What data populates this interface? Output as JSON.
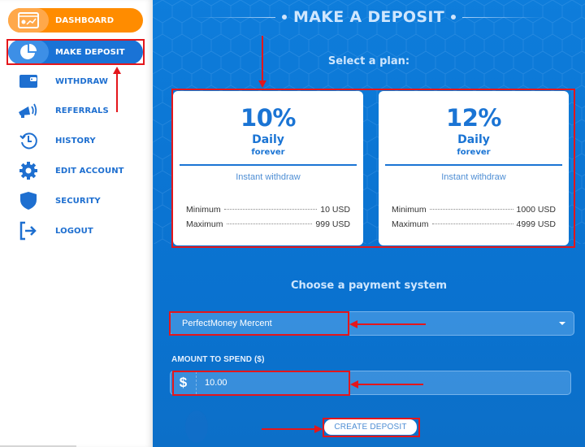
{
  "sidebar": {
    "items": [
      {
        "label": "DASHBOARD",
        "icon": "dashboard-chart-icon",
        "state": "highlighted"
      },
      {
        "label": "MAKE DEPOSIT",
        "icon": "pie-chart-icon",
        "state": "active"
      },
      {
        "label": "WITHDRAW",
        "icon": "wallet-icon",
        "state": "normal"
      },
      {
        "label": "REFERRALS",
        "icon": "megaphone-icon",
        "state": "normal"
      },
      {
        "label": "HISTORY",
        "icon": "history-clock-icon",
        "state": "normal"
      },
      {
        "label": "EDIT ACCOUNT",
        "icon": "gear-icon",
        "state": "normal"
      },
      {
        "label": "SECURITY",
        "icon": "shield-icon",
        "state": "normal"
      },
      {
        "label": "LOGOUT",
        "icon": "logout-icon",
        "state": "normal"
      }
    ]
  },
  "main": {
    "title": "MAKE A DEPOSIT",
    "select_plan_heading": "Select a plan:",
    "plans": [
      {
        "percent": "10%",
        "period": "Daily",
        "duration": "forever",
        "feature": "Instant withdraw",
        "min_label": "Minimum",
        "min_value": "10 USD",
        "max_label": "Maximum",
        "max_value": "999 USD"
      },
      {
        "percent": "12%",
        "period": "Daily",
        "duration": "forever",
        "feature": "Instant withdraw",
        "min_label": "Minimum",
        "min_value": "1000 USD",
        "max_label": "Maximum",
        "max_value": "4999 USD"
      }
    ],
    "payment_heading": "Choose a payment system",
    "payment_select": {
      "selected": "PerfectMoney Mercent"
    },
    "amount": {
      "label": "AMOUNT TO SPEND ($)",
      "currency_symbol": "$",
      "value": "10.00"
    },
    "create_button": "CREATE DEPOSIT"
  },
  "colors": {
    "accent_blue": "#1a74d4",
    "orange": "#ff8c00",
    "annotation_red": "#e4161b",
    "main_background": "#0b74d2"
  }
}
